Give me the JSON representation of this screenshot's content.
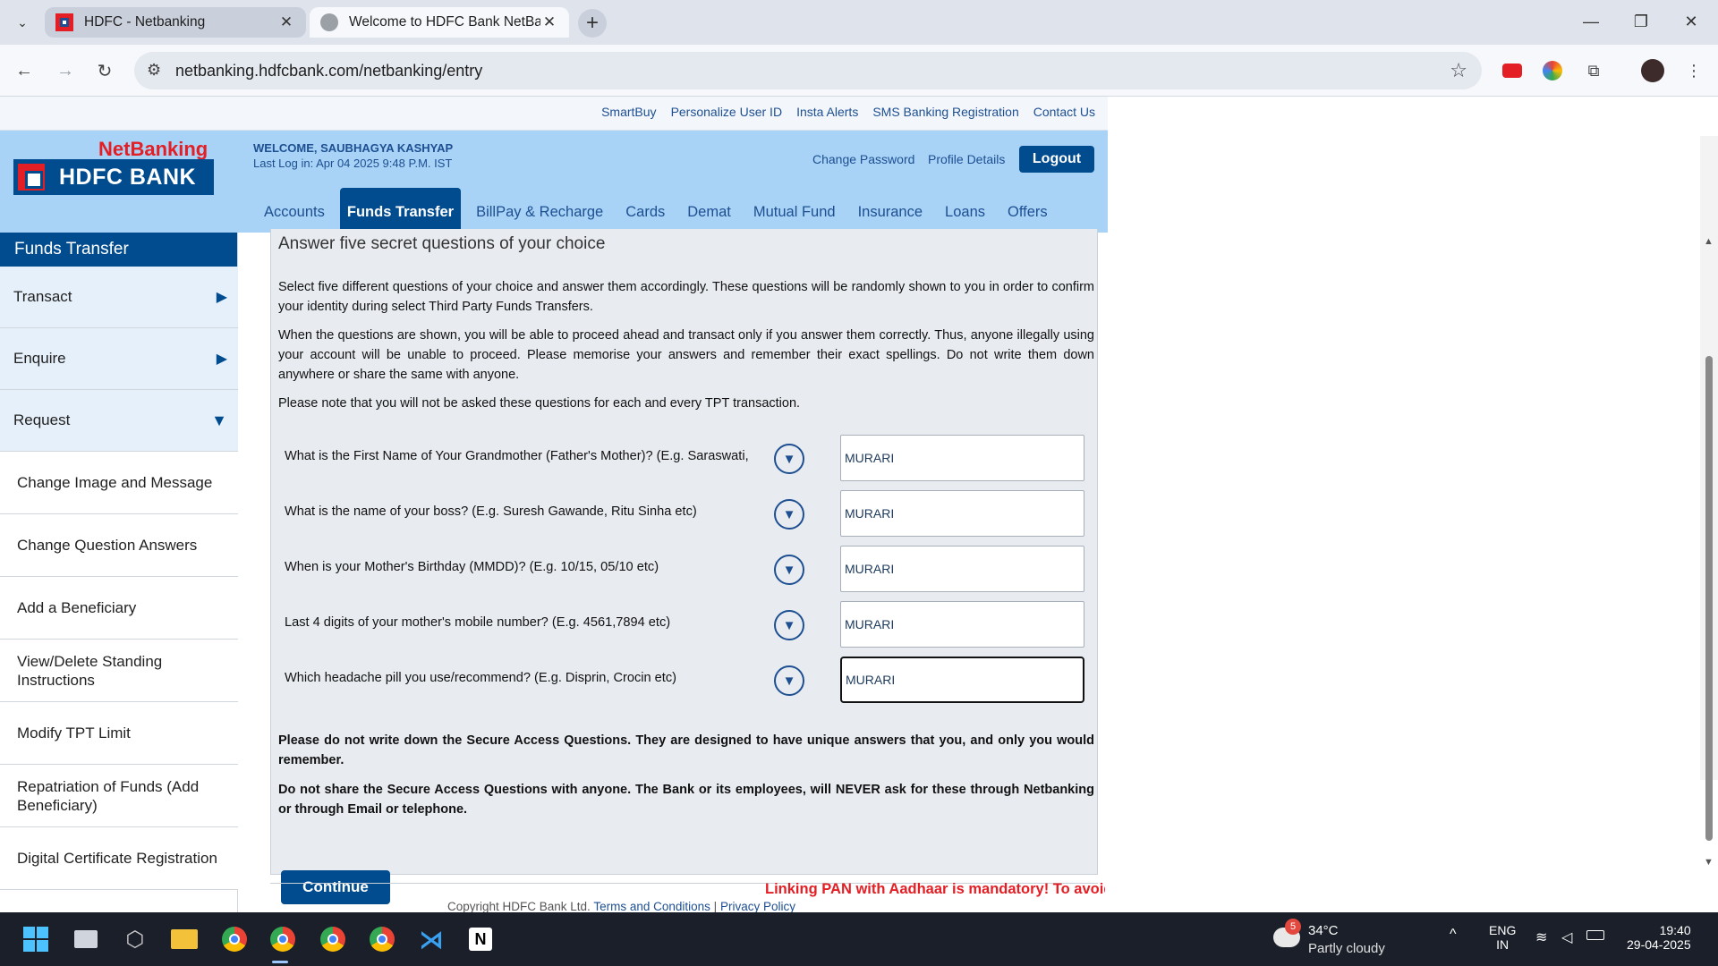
{
  "browser": {
    "tabs": [
      {
        "title": "HDFC - Netbanking",
        "active": false
      },
      {
        "title": "Welcome to HDFC Bank NetBanking",
        "active": true
      }
    ],
    "url": "netbanking.hdfcbank.com/netbanking/entry"
  },
  "toplinks": [
    "SmartBuy",
    "Personalize User ID",
    "Insta Alerts",
    "SMS Banking Registration",
    "Contact Us"
  ],
  "header": {
    "logo_netbanking": "NetBanking",
    "logo_bank": "HDFC BANK",
    "welcome": "WELCOME, SAUBHAGYA KASHYAP",
    "last_login": "Last Log in: Apr 04 2025 9:48 P.M. IST",
    "change_password": "Change Password",
    "profile_details": "Profile Details",
    "logout": "Logout",
    "nav": [
      "Accounts",
      "Funds Transfer",
      "BillPay & Recharge",
      "Cards",
      "Demat",
      "Mutual Fund",
      "Insurance",
      "Loans",
      "Offers"
    ],
    "active_nav": "Funds Transfer"
  },
  "sidebar": {
    "title": "Funds Transfer",
    "sections": [
      {
        "label": "Transact",
        "state": "collapsed"
      },
      {
        "label": "Enquire",
        "state": "collapsed"
      },
      {
        "label": "Request",
        "state": "expanded"
      }
    ],
    "items": [
      "Change Image and Message",
      "Change Question Answers",
      "Add a Beneficiary",
      "View/Delete Standing Instructions",
      "Modify TPT Limit",
      "Repatriation of Funds (Add Beneficiary)",
      "Digital Certificate Registration"
    ]
  },
  "content": {
    "heading": "Answer five secret questions of your choice",
    "para1": "Select five different questions of your choice and answer them accordingly. These questions will be randomly shown to you in order to confirm your identity during select Third Party Funds Transfers.",
    "para2": "When the questions are shown, you will be able to proceed ahead and transact only if you answer them correctly. Thus, anyone illegally using your account will be unable to proceed. Please memorise your answers and remember their exact spellings. Do not write them down anywhere or share the same with anyone.",
    "para3": "Please note that you will not be asked these questions for each and every TPT transaction.",
    "questions": [
      {
        "question": "What is the First Name of Your Grandmother (Father's Mother)? (E.g. Saraswati,",
        "answer": "MURARI"
      },
      {
        "question": "What is the name of your boss? (E.g. Suresh Gawande, Ritu Sinha etc)",
        "answer": "MURARI"
      },
      {
        "question": "When is your Mother's Birthday (MMDD)? (E.g. 10/15, 05/10 etc)",
        "answer": "MURARI"
      },
      {
        "question": "Last 4 digits of your mother's mobile number? (E.g. 4561,7894 etc)",
        "answer": "MURARI"
      },
      {
        "question": "Which headache pill you use/recommend? (E.g. Disprin, Crocin etc)",
        "answer": "MURARI"
      }
    ],
    "warning1": "Please do not write down the Secure Access Questions. They are designed to have unique answers that you, and only you would remember.",
    "warning2": "Do not share the Secure Access Questions with anyone. The Bank or its employees, will NEVER ask for these through Netbanking or through Email or telephone.",
    "continue": "Continue"
  },
  "footer": {
    "ticker": "Linking PAN with Aadhaar is mandatory! To avoid",
    "copyright": "Copyright HDFC Bank Ltd.",
    "terms": "Terms and Conditions",
    "separator": "|",
    "privacy": "Privacy Policy"
  },
  "taskbar": {
    "weather_badge": "5",
    "temp": "34°C",
    "weather": "Partly cloudy",
    "lang1": "ENG",
    "lang2": "IN",
    "time": "19:40",
    "date": "29-04-2025"
  }
}
